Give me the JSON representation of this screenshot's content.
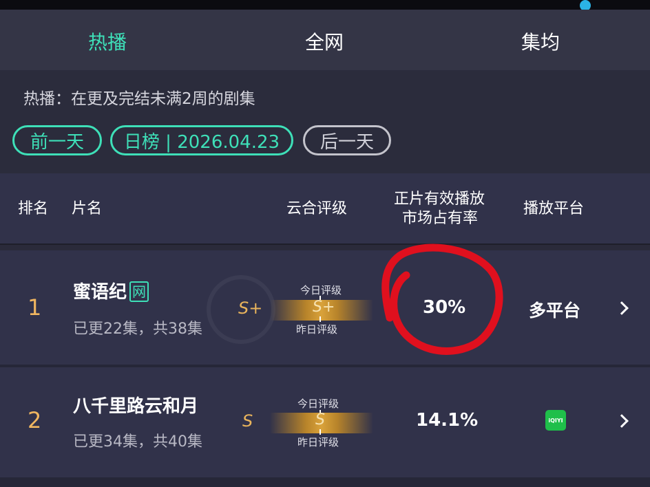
{
  "tabs": [
    {
      "label": "热播",
      "active": true
    },
    {
      "label": "全网",
      "active": false
    },
    {
      "label": "集均",
      "active": false
    }
  ],
  "description": "热播：在更及完结未满2周的剧集",
  "date_nav": {
    "prev": "前一天",
    "current": "日榜 | 2026.04.23",
    "next": "后一天"
  },
  "table": {
    "headers": {
      "rank": "排名",
      "name": "片名",
      "rating": "云合评级",
      "share_line1": "正片有效播放",
      "share_line2": "市场占有率",
      "platform": "播放平台"
    },
    "rows": [
      {
        "rank": "1",
        "title": "蜜语纪",
        "badge": "网",
        "sub": "已更22集，共38集",
        "grade": "S+",
        "today_label": "今日评级",
        "bar_grade": "S+",
        "yesterday_label": "昨日评级",
        "share": "30%",
        "platform": "多平台"
      },
      {
        "rank": "2",
        "title": "八千里路云和月",
        "sub": "已更34集，共40集",
        "grade": "S",
        "today_label": "今日评级",
        "bar_grade": "S",
        "yesterday_label": "昨日评级",
        "share": "14.1%",
        "platform_icon": "iqiyi-logo-icon",
        "platform_icon_text": "iQIYI"
      }
    ]
  },
  "colors": {
    "accent": "#3ee0b8",
    "rank": "#f0b660",
    "annotation": "#e0101e"
  }
}
